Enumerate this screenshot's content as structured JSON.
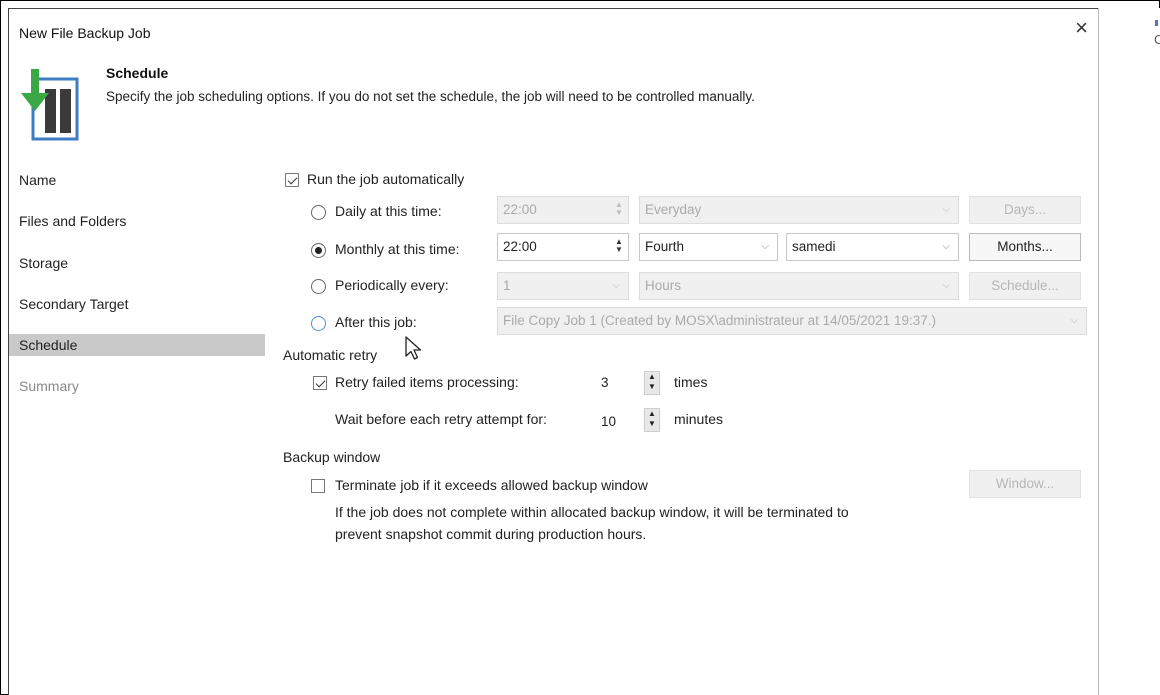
{
  "window": {
    "title": "New File Backup Job",
    "close_glyph": "×"
  },
  "header": {
    "title": "Schedule",
    "description": "Specify the job scheduling options. If you do not set the schedule, the job will need to be controlled manually."
  },
  "nav": {
    "items": [
      {
        "label": "Name",
        "state": "normal"
      },
      {
        "label": "Files and Folders",
        "state": "normal"
      },
      {
        "label": "Storage",
        "state": "normal"
      },
      {
        "label": "Secondary Target",
        "state": "normal"
      },
      {
        "label": "Schedule",
        "state": "active"
      },
      {
        "label": "Summary",
        "state": "disabled"
      }
    ]
  },
  "schedule": {
    "run_auto": {
      "label": "Run the job automatically",
      "checked": true
    },
    "daily": {
      "label": "Daily at this time:",
      "time": "22:00",
      "frequency": "Everyday",
      "button": "Days...",
      "selected": false
    },
    "monthly": {
      "label": "Monthly at this time:",
      "time": "22:00",
      "week": "Fourth",
      "day": "samedi",
      "button": "Months...",
      "selected": true
    },
    "periodically": {
      "label": "Periodically every:",
      "value": "1",
      "unit": "Hours",
      "button": "Schedule...",
      "selected": false
    },
    "after_job": {
      "label": "After this job:",
      "job": "File Copy Job 1 (Created by MOSX\\administrateur at 14/05/2021 19:37.)",
      "selected": false
    }
  },
  "retry": {
    "section_label": "Automatic retry",
    "retry_failed": {
      "label": "Retry failed items processing:",
      "checked": true,
      "value": "3",
      "unit": "times"
    },
    "wait": {
      "label": "Wait before each retry attempt for:",
      "value": "10",
      "unit": "minutes"
    }
  },
  "backup_window": {
    "section_label": "Backup window",
    "terminate": {
      "label": "Terminate job if it exceeds allowed backup window",
      "checked": false
    },
    "button": "Window...",
    "note_line1": "If the job does not complete within allocated backup window, it will be terminated to",
    "note_line2": "prevent snapshot commit during production hours."
  },
  "background_window": {
    "partial_char": "C"
  },
  "colors": {
    "active_nav": "#c9c9c9",
    "icon_green": "#3aa845",
    "icon_blue": "#3e7cc4",
    "radio_focus": "#4a8fd8"
  }
}
